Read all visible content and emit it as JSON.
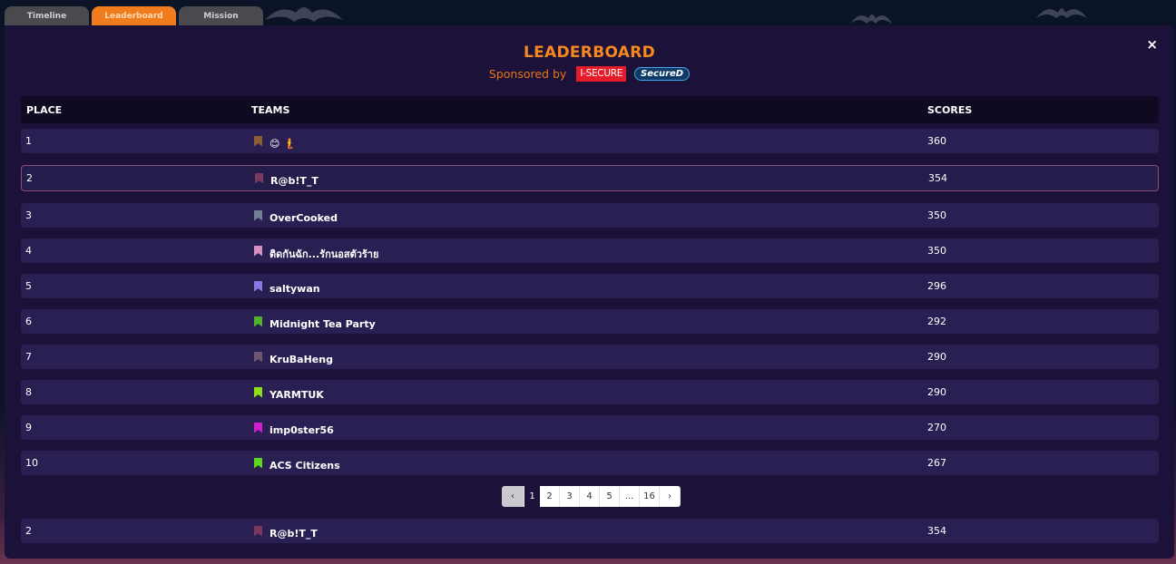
{
  "tabs": [
    {
      "label": "Timeline",
      "active": false
    },
    {
      "label": "Leaderboard",
      "active": true
    },
    {
      "label": "Mission",
      "active": false
    }
  ],
  "modal": {
    "title": "LEADERBOARD",
    "sponsored_by": "Sponsored by",
    "sponsor_logos": [
      "I-SECURE",
      "SecureD"
    ],
    "close_icon": "×"
  },
  "columns": {
    "place": "PLACE",
    "teams": "TEAMS",
    "scores": "SCORES"
  },
  "rows": [
    {
      "place": "1",
      "team": "😊 🧜",
      "score": "360",
      "flag_color": "#8b5e34"
    },
    {
      "place": "2",
      "team": "R@b!T_T",
      "score": "354",
      "flag_color": "#7a3a5e"
    },
    {
      "place": "3",
      "team": "OverCooked",
      "score": "350",
      "flag_color": "#6f8090"
    },
    {
      "place": "4",
      "team": "ติดกันฉัก...รักนอสตัวร้าย",
      "score": "350",
      "flag_color": "#d88fc0"
    },
    {
      "place": "5",
      "team": "saltywan",
      "score": "296",
      "flag_color": "#8b78e6"
    },
    {
      "place": "6",
      "team": "Midnight Tea Party",
      "score": "292",
      "flag_color": "#52b22a"
    },
    {
      "place": "7",
      "team": "KruBaHeng",
      "score": "290",
      "flag_color": "#6d5672"
    },
    {
      "place": "8",
      "team": "YARMTUK",
      "score": "290",
      "flag_color": "#8be016"
    },
    {
      "place": "9",
      "team": "imp0ster56",
      "score": "270",
      "flag_color": "#d01fcf"
    },
    {
      "place": "10",
      "team": "ACS Citizens",
      "score": "267",
      "flag_color": "#5fd81c"
    }
  ],
  "pagination": {
    "prev_icon": "‹",
    "pages": [
      "1",
      "2",
      "3",
      "4",
      "5",
      "...",
      "16"
    ],
    "current": "1",
    "next_icon": "›"
  },
  "my_team": {
    "place": "2",
    "team": "R@b!T_T",
    "score": "354",
    "flag_color": "#7a3a5e"
  }
}
